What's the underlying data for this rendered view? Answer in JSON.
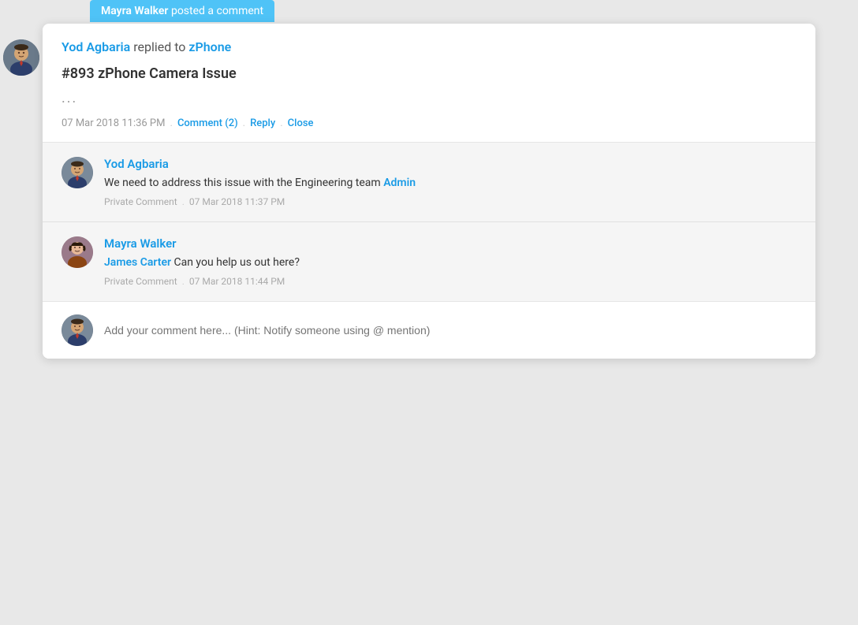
{
  "notification": {
    "text": "posted a comment",
    "author": "Mayra Walker"
  },
  "header": {
    "replied_by": "Yod Agbaria",
    "replied_to": "zPhone",
    "replied_label": "replied to",
    "ticket_title": "#893 zPhone Camera Issue",
    "ellipsis": "...",
    "timestamp": "07 Mar 2018 11:36 PM",
    "comment_label": "Comment (2)",
    "reply_label": "Reply",
    "close_label": "Close"
  },
  "comments": [
    {
      "author": "Yod Agbaria",
      "text_before_mention": "We need to address this issue with the Engineering team ",
      "mention": "Admin",
      "text_after_mention": "",
      "label": "Private Comment",
      "timestamp": "07 Mar 2018 11:37 PM",
      "avatar_type": "yod"
    },
    {
      "author": "Mayra Walker",
      "mention": "James Carter",
      "text_before_mention": "",
      "text_after_mention": " Can you help us out here?",
      "label": "Private Comment",
      "timestamp": "07 Mar 2018 11:44 PM",
      "avatar_type": "mayra"
    }
  ],
  "input": {
    "placeholder": "Add your comment here... (Hint: Notify someone using @ mention)"
  },
  "colors": {
    "accent": "#1a9be6",
    "text_primary": "#333",
    "text_muted": "#999"
  }
}
